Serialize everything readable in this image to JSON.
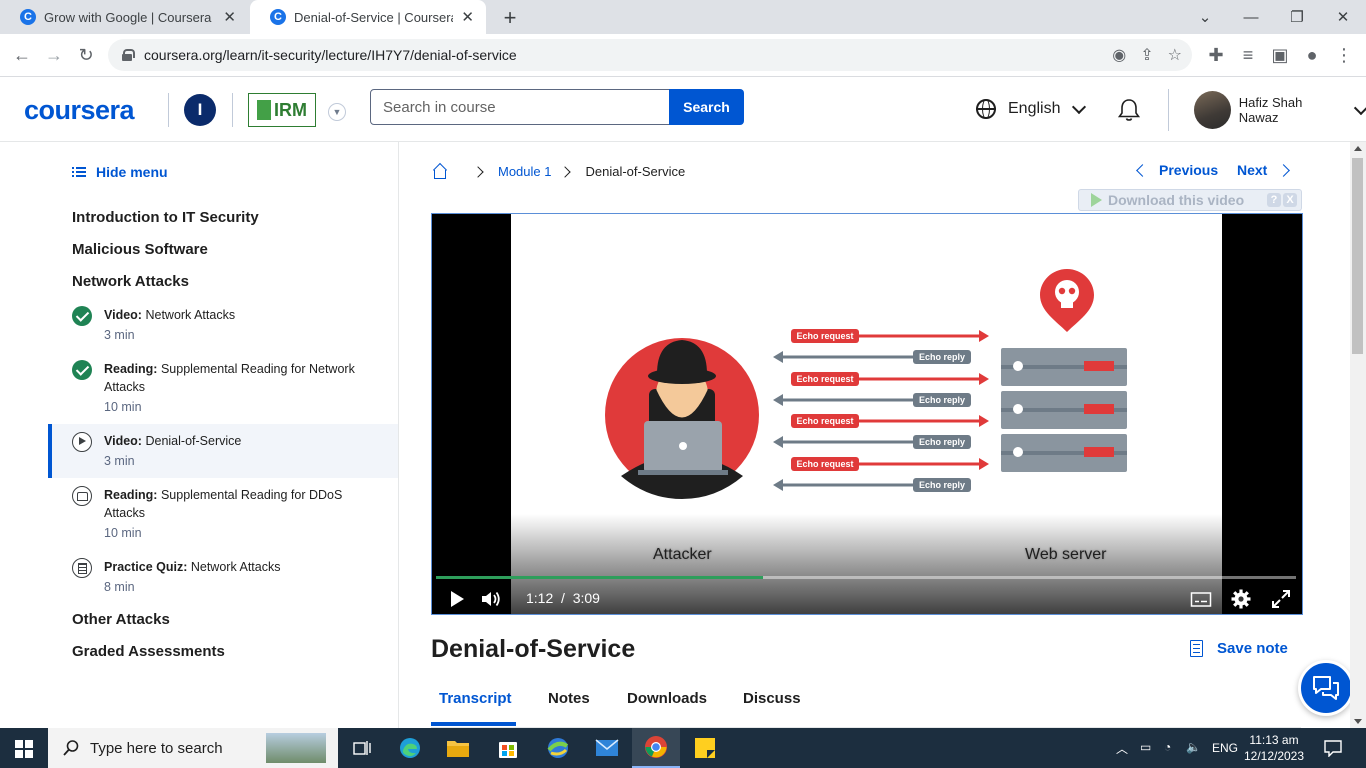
{
  "browser": {
    "tabs": [
      {
        "title": "Grow with Google | Coursera",
        "active": false
      },
      {
        "title": "Denial-of-Service | Coursera",
        "active": true
      }
    ],
    "url": "coursera.org/learn/it-security/lecture/IH7Y7/denial-of-service"
  },
  "header": {
    "logo": "coursera",
    "org_badge": "I",
    "partner_logo": "IRM",
    "search": {
      "placeholder": "Search in course",
      "button": "Search"
    },
    "language": "English",
    "user_name": "Hafiz Shah Nawaz"
  },
  "sidebar": {
    "hide_menu": "Hide menu",
    "sections": [
      "Introduction to IT Security",
      "Malicious Software",
      "Network Attacks",
      "Other Attacks",
      "Graded Assessments"
    ],
    "items": [
      {
        "kind": "Video:",
        "title": "Network Attacks",
        "duration": "3 min",
        "status": "completed",
        "icon": "check-icon"
      },
      {
        "kind": "Reading:",
        "title": "Supplemental Reading for Network Attacks",
        "duration": "10 min",
        "status": "completed",
        "icon": "check-icon"
      },
      {
        "kind": "Video:",
        "title": "Denial-of-Service",
        "duration": "3 min",
        "status": "current",
        "icon": "play-icon"
      },
      {
        "kind": "Reading:",
        "title": "Supplemental Reading for DDoS Attacks",
        "duration": "10 min",
        "status": "not-started",
        "icon": "book-icon"
      },
      {
        "kind": "Practice Quiz:",
        "title": "Network Attacks",
        "duration": "8 min",
        "status": "not-started",
        "icon": "quiz-icon"
      }
    ]
  },
  "main": {
    "breadcrumb": {
      "module": "Module 1",
      "current": "Denial-of-Service"
    },
    "previous": "Previous",
    "next": "Next",
    "download_video": "Download this video",
    "download_help": "?",
    "download_close": "X",
    "video": {
      "current_time": "1:12",
      "separator": "/",
      "duration": "3:09",
      "progress": 0.38,
      "illustration": {
        "attacker_label": "Attacker",
        "server_label": "Web server",
        "request_label": "Echo request",
        "reply_label": "Echo reply"
      }
    },
    "lesson_title": "Denial-of-Service",
    "save_note": "Save note",
    "tabs": [
      "Transcript",
      "Notes",
      "Downloads",
      "Discuss"
    ],
    "selected_tab": "Transcript"
  },
  "taskbar": {
    "search_placeholder": "Type here to search",
    "language": "ENG",
    "time": "11:13 am",
    "date": "12/12/2023"
  },
  "colors": {
    "brand": "#0056d2",
    "complete": "#1f8354",
    "attack_red": "#e03a3a",
    "reply_gray": "#6e7b87"
  }
}
